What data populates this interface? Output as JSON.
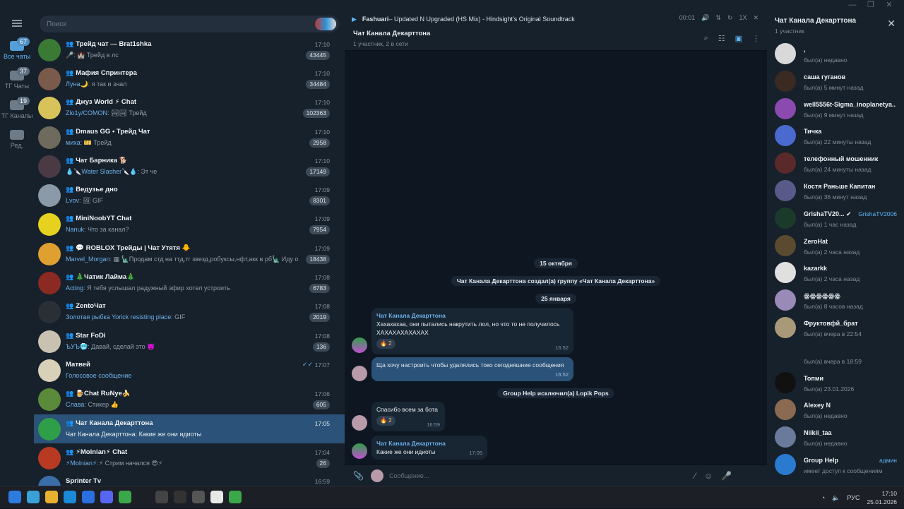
{
  "window_controls": [
    "—",
    "❐",
    "✕"
  ],
  "rail": {
    "items": [
      {
        "label": "Все чаты",
        "badge": "67",
        "active": true
      },
      {
        "label": "ТГ Чаты",
        "badge": "37"
      },
      {
        "label": "ТГ Каналы",
        "badge": "19"
      },
      {
        "label": "Ред."
      }
    ]
  },
  "search": {
    "placeholder": "Поиск"
  },
  "chats": [
    {
      "name": "Трейд чат — Brat1shka",
      "time": "17:10",
      "sender": "",
      "msg": "🎤: 🏰 Трейд в лс",
      "unread": "43445",
      "color": "#3b7a35",
      "group": true
    },
    {
      "name": "Мафия Спринтера",
      "time": "17:10",
      "sender": "Луна🌙",
      "msg": ": я так и знал",
      "unread": "34484",
      "color": "#7a5a4a",
      "group": true
    },
    {
      "name": "Джуз World ⚡ Chat",
      "time": "17:10",
      "sender": "Zlo1y/COMON",
      "msg": ": 🏞🏞 Трейд",
      "unread": "102363",
      "color": "#d8c35a",
      "group": true
    },
    {
      "name": "Dmaus GG • Трейд Чат",
      "time": "17:10",
      "sender": "миха",
      "msg": ": 🎫 Трейд",
      "unread": "2958",
      "color": "#6e6a5c",
      "group": true
    },
    {
      "name": "Чат Барника 🐕",
      "time": "17:10",
      "sender": "💧🔪Water Slasher🔪💧",
      "msg": ": Эт че",
      "unread": "17149",
      "color": "#4a3a44",
      "group": true
    },
    {
      "name": "Ведузье дно",
      "time": "17:09",
      "sender": "Lvov",
      "msg": ": 🖼 GIF",
      "unread": "8301",
      "color": "#8a9aa8",
      "group": true
    },
    {
      "name": "MiniNoobYT Chat",
      "time": "17:09",
      "sender": "Nanuk",
      "msg": ": Что за канал?",
      "unread": "7954",
      "color": "#e6d21e",
      "group": true
    },
    {
      "name": "💬 ROBLOX Трейды | Чат Утятя 🐥",
      "time": "17:09",
      "sender": "Marvel_Morgan",
      "msg": ": ▦ 🗽Продам стд на ттд,тг звезд,робуксы,нфт,акк в рб🗽 Иду онл...",
      "unread": "18438",
      "color": "#e0a030",
      "group": true
    },
    {
      "name": "🎄Чатик Лайма🎄",
      "time": "17:08",
      "sender": "Acting",
      "msg": ": Я тебя услышал радужный эфир хотел устроить",
      "unread": "6783",
      "color": "#8a2a22",
      "group": true
    },
    {
      "name": "ZentoЧат",
      "time": "17:08",
      "sender": "Золотая рыбка Yorick resisting place",
      "msg": ": GIF",
      "unread": "2019",
      "color": "#2a2f36",
      "group": true
    },
    {
      "name": "Star FoDi",
      "time": "17:08",
      "sender": "ЪУЪ🥶",
      "msg": ": Давай, сделай это 👿",
      "unread": "136",
      "color": "#c9c2b0",
      "group": true
    },
    {
      "name": "Матвей",
      "time": "17:07",
      "sender": "Голосовое сообщение",
      "msg": "",
      "unread": "",
      "color": "#d8d0b8",
      "group": false,
      "read": "✓✓"
    },
    {
      "name": "🍺Chat RuNye🍌",
      "time": "17:06",
      "sender": "Слава",
      "msg": ": Стикер 👍",
      "unread": "605",
      "color": "#5a8a3a",
      "group": true
    },
    {
      "name": "Чат Канала Декарттона",
      "time": "17:05",
      "sender": "",
      "msg": "Чат Канала Декарттона: Какие же они идиоты",
      "unread": "",
      "color": "#2f9e48",
      "group": true,
      "active": true
    },
    {
      "name": "⚡Molnian⚡ Chat",
      "time": "17:04",
      "sender": "⚡Molnian⚡",
      "msg": ":⚡ Стрим начался 😎⚡",
      "unread": "26",
      "color": "#b83a22",
      "group": true
    },
    {
      "name": "Sprinter Tv",
      "time": "16:59",
      "sender": "",
      "msg": "",
      "unread": "",
      "color": "#3a6ea8",
      "group": false
    }
  ],
  "player": {
    "artist": "Fashuari",
    "track": " – Updated N Upgraded (HS Mix) - Hindsight's Original Soundtrack",
    "time": "00:01",
    "speed": "1X"
  },
  "chat": {
    "title": "Чат Канала Декарттона",
    "subtitle": "1 участник, 2 в сети",
    "date1": "15 октября",
    "service1": "Чат Канала Декарттона создал(а) группу «Чат Канала Декарттона»",
    "date2": "25 января",
    "m1_sender": "Чат Канала Декарттона",
    "m1_text": "Хахахахаа, они пытались накрутить лол, но что то не получилось ХАХАХАХАХАХАХ",
    "m1_react": "🔥 2",
    "m1_time": "16:52",
    "m2_text": "Ща хочу настроить чтобы удалялись токо сегодняшние сообщения",
    "m2_time": "16:52",
    "service2": "Group Help исключил(а) Lopik Pops",
    "m3_text": "Спасибо всем за бота",
    "m3_react": "🔥 2",
    "m3_time": "16:59",
    "m4_sender": "Чат Канала Декарттона",
    "m4_text": "Какие же они идиоты",
    "m4_time": "17:05",
    "composer_placeholder": "Сообщение..."
  },
  "panel": {
    "title": "Чат Канала Декарттона",
    "subtitle": "1 участник",
    "members": [
      {
        "name": ",",
        "status": "был(а) недавно",
        "color": "#d9d9d9"
      },
      {
        "name": "саша гуганов",
        "status": "был(а) 5 минут назад",
        "color": "#3a2a22"
      },
      {
        "name": "well5556t-Sigma_inoplanetya...",
        "status": "был(а) 9 минут назад",
        "color": "#8a4ab0"
      },
      {
        "name": "Тичка",
        "status": "был(а) 22 минуты назад",
        "color": "#4a6ad0"
      },
      {
        "name": "телефонный мошенник",
        "status": "был(а) 24 минуты назад",
        "color": "#5a2a2a"
      },
      {
        "name": "Костя Раньше Капитан",
        "status": "был(а) 36 минут назад",
        "color": "#5a5a8a"
      },
      {
        "name": "GrishaTV20... ✔",
        "status": "был(а) 1 час назад",
        "color": "#1a3a2a",
        "role": "GrishaTV2006"
      },
      {
        "name": "ZeroHat",
        "status": "был(а) 2 часа назад",
        "color": "#5a4a30"
      },
      {
        "name": "kazarkk",
        "status": "был(а) 2 часа назад",
        "color": "#e0e0e0"
      },
      {
        "name": "ꙮꙮꙮꙮꙮꙮ",
        "status": "был(а) 8 часов назад",
        "color": "#9a8ab8"
      },
      {
        "name": "Фруктовфй_брат",
        "status": "был(а) вчера в 22:54",
        "color": "#a89a78"
      },
      {
        "name": "",
        "status": "был(а) вчера в 18:59",
        "color": "#17212b"
      },
      {
        "name": "Топми",
        "status": "был(а) 23.01.2026",
        "color": "#111111"
      },
      {
        "name": "Alexey N",
        "status": "был(а) недавно",
        "color": "#8a6a50"
      },
      {
        "name": "Niikii_taa",
        "status": "был(а) недавно",
        "color": "#6a7a9a"
      },
      {
        "name": "Group Help",
        "status": "имеет доступ к сообщениям",
        "color": "#2a7ad0",
        "role": "админ"
      }
    ]
  },
  "taskbar": {
    "apps": [
      "#2b7be0",
      "#3aa0d8",
      "#e8b030",
      "#1a8ad8",
      "#2a6fe0",
      "#5865f2",
      "#3aa848",
      "#1c1f26",
      "#444",
      "#333",
      "#555",
      "#e8e8e8",
      "#3aa848"
    ],
    "lang": "РУС",
    "time": "17:10",
    "date": "25.01.2026"
  }
}
